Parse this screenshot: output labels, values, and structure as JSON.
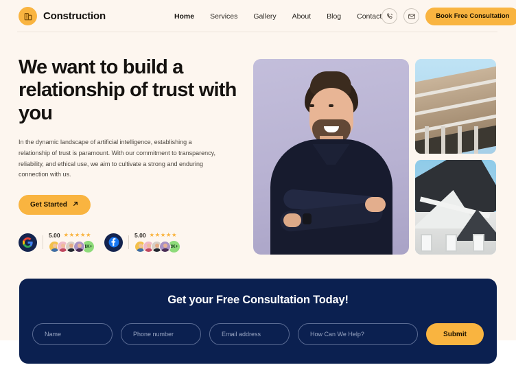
{
  "header": {
    "brand_name": "Construction",
    "brand_icon": "building-icon",
    "nav": [
      {
        "label": "Home",
        "active": true
      },
      {
        "label": "Services",
        "active": false
      },
      {
        "label": "Gallery",
        "active": false
      },
      {
        "label": "About",
        "active": false
      },
      {
        "label": "Blog",
        "active": false
      },
      {
        "label": "Contact",
        "active": false
      }
    ],
    "phone_icon": "phone-icon",
    "mail_icon": "mail-icon",
    "cta_label": "Book Free Consultation"
  },
  "hero": {
    "title": "We want to build a relationship of trust with you",
    "paragraph": "In the dynamic landscape of artificial intelligence, establishing a relationship of trust is paramount. With our commitment to transparency, reliability, and ethical use, we aim to cultivate a strong and enduring connection with us.",
    "get_started_label": "Get Started",
    "get_started_icon": "arrow-up-right-icon",
    "social_proof": [
      {
        "platform": "Google",
        "logo_icon": "google-icon",
        "score": "5.00",
        "stars": "★★★★★",
        "star_count": 5,
        "count_badge": "1K+"
      },
      {
        "platform": "Facebook",
        "logo_icon": "facebook-icon",
        "score": "5.00",
        "stars": "★★★★★",
        "star_count": 5,
        "count_badge": "2K+"
      }
    ],
    "images": {
      "main_alt": "portrait-man-arms-crossed",
      "side_top_alt": "building-under-construction",
      "side_bottom_alt": "white-house-gable"
    }
  },
  "consultation": {
    "title": "Get your Free Consultation Today!",
    "fields": [
      {
        "name": "name",
        "placeholder": "Name",
        "value": ""
      },
      {
        "name": "phone",
        "placeholder": "Phone number",
        "value": ""
      },
      {
        "name": "email",
        "placeholder": "Email address",
        "value": ""
      },
      {
        "name": "help",
        "placeholder": "How Can We Help?",
        "value": ""
      }
    ],
    "submit_label": "Submit"
  },
  "colors": {
    "accent": "#f9b440",
    "navy": "#0b2050",
    "cream": "#fdf6ef",
    "text": "#15120f"
  }
}
